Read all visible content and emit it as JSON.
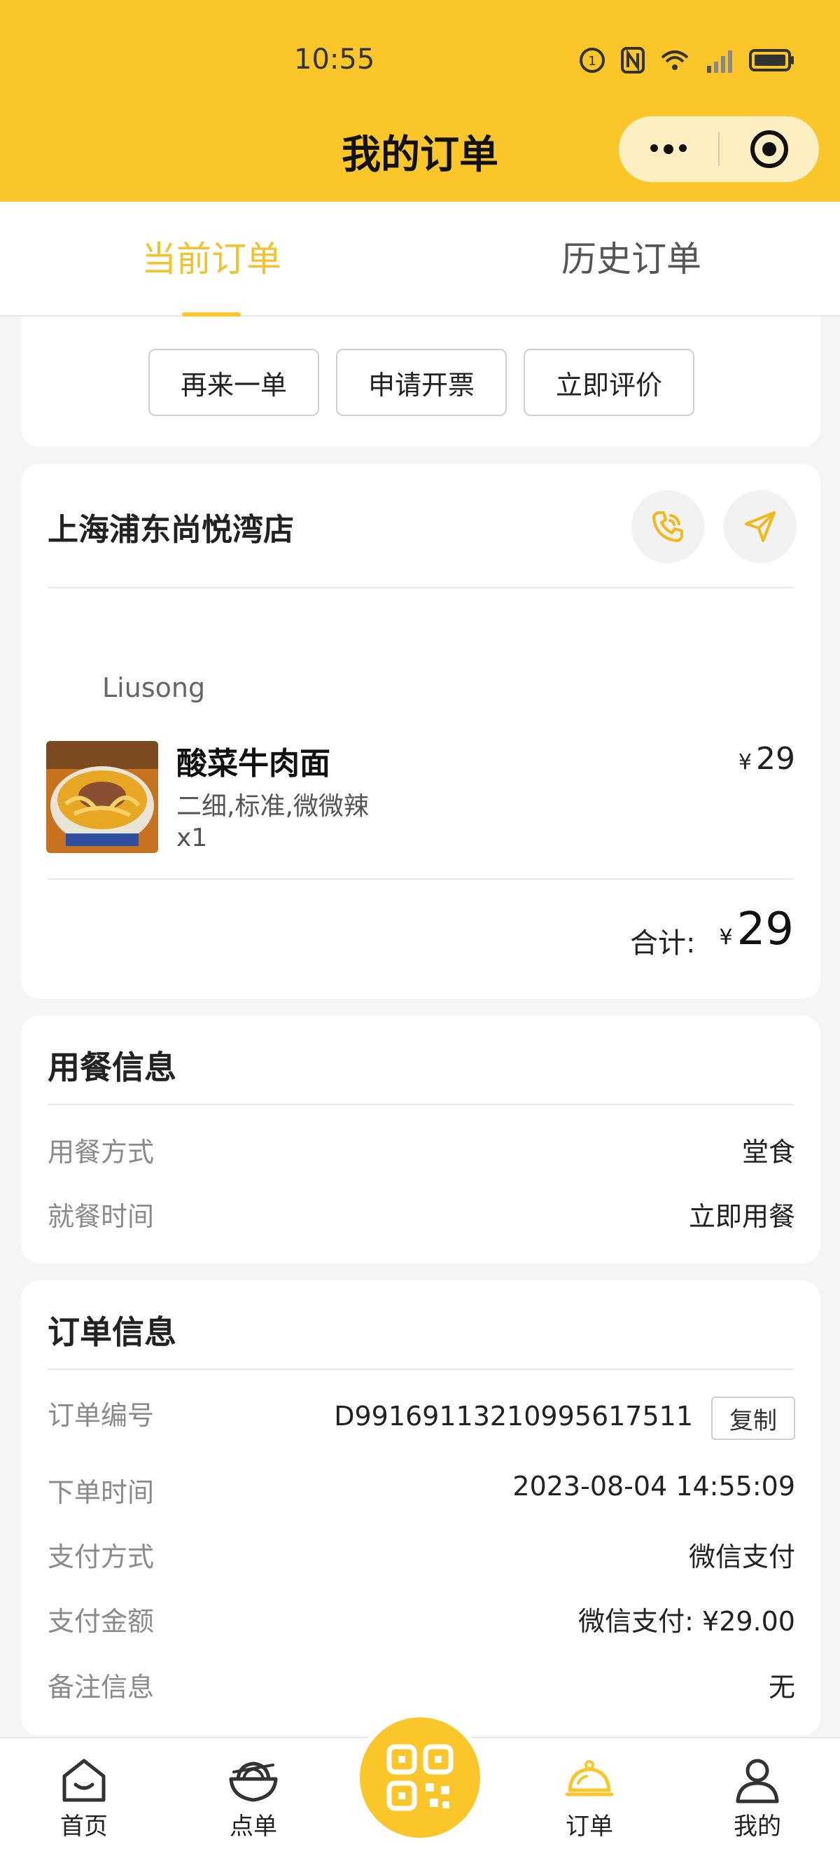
{
  "status_bar": {
    "time": "10:55",
    "network": "4G"
  },
  "header": {
    "title": "我的订单"
  },
  "tabs": [
    {
      "label": "当前订单",
      "active": true
    },
    {
      "label": "历史订单",
      "active": false
    }
  ],
  "actions": {
    "reorder": "再来一单",
    "invoice": "申请开票",
    "review": "立即评价"
  },
  "store": {
    "name": "上海浦东尚悦湾店",
    "cook": "Liusong",
    "item": {
      "name": "酸菜牛肉面",
      "spec": "二细,标准,微微辣",
      "qty": "x1",
      "currency": "¥",
      "price": "29"
    },
    "total_label": "合计:",
    "total_currency": "¥",
    "total": "29"
  },
  "dining": {
    "title": "用餐信息",
    "rows": [
      {
        "label": "用餐方式",
        "value": "堂食"
      },
      {
        "label": "就餐时间",
        "value": "立即用餐"
      }
    ]
  },
  "order": {
    "title": "订单信息",
    "copy_label": "复制",
    "rows": [
      {
        "label": "订单编号",
        "value": "D991691132109956175​11"
      },
      {
        "label": "下单时间",
        "value": "2023-08-04 14:55:09"
      },
      {
        "label": "支付方式",
        "value": "微信支付"
      },
      {
        "label": "支付金额",
        "value": "微信支付: ¥29.00"
      },
      {
        "label": "备注信息",
        "value": "无"
      }
    ]
  },
  "bottom_nav": {
    "home": "首页",
    "menu": "点单",
    "orders": "订单",
    "me": "我的"
  },
  "colors": {
    "accent": "#fbc62a",
    "tab_active": "#f2c230"
  }
}
